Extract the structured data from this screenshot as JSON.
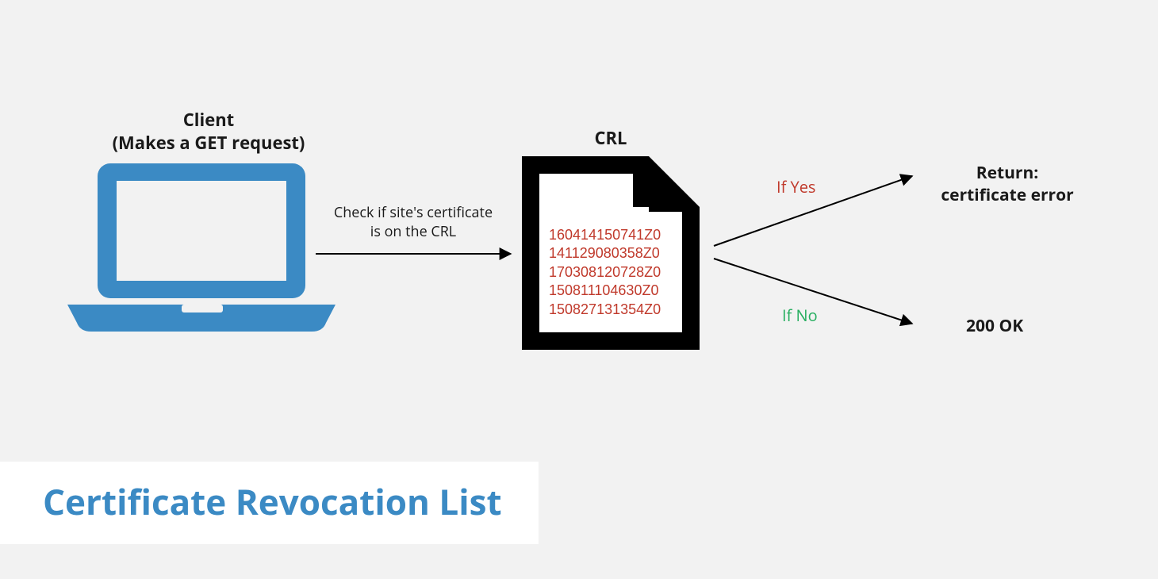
{
  "client": {
    "line1": "Client",
    "line2": "(Makes a GET request)"
  },
  "crl_label": "CRL",
  "arrow1_line1": "Check if site's certificate",
  "arrow1_line2": "is on the CRL",
  "crl_entries": [
    "160414150741Z0",
    "141129080358Z0",
    "170308120728Z0",
    "150811104630Z0",
    "150827131354Z0"
  ],
  "if_yes": "If Yes",
  "if_no": "If No",
  "return_line1": "Return:",
  "return_line2": "certificate error",
  "ok_label": "200 OK",
  "title": "Certificate Revocation List",
  "colors": {
    "accent_blue": "#3b8ac4",
    "red": "#c0392b",
    "green": "#27ae60",
    "black": "#000000"
  }
}
